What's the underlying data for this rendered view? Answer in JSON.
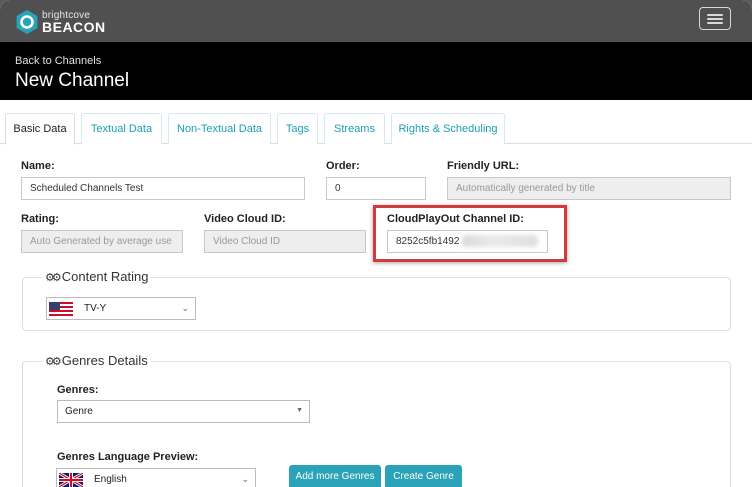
{
  "brand": {
    "small": "brightcove",
    "big": "BEACON",
    "color": "#2aa3b9"
  },
  "header": {
    "back_link": "Back to Channels",
    "title": "New Channel"
  },
  "tabs": [
    {
      "label": "Basic Data",
      "active": true
    },
    {
      "label": "Textual Data",
      "active": false
    },
    {
      "label": "Non-Textual Data",
      "active": false
    },
    {
      "label": "Tags",
      "active": false
    },
    {
      "label": "Streams",
      "active": false
    },
    {
      "label": "Rights & Scheduling",
      "active": false
    }
  ],
  "form": {
    "name": {
      "label": "Name:",
      "value": "Scheduled Channels Test"
    },
    "order": {
      "label": "Order:",
      "value": "0"
    },
    "friendly_url": {
      "label": "Friendly URL:",
      "placeholder": "Automatically generated by title"
    },
    "rating": {
      "label": "Rating:",
      "placeholder": "Auto Generated by average use"
    },
    "video_cloud_id": {
      "label": "Video Cloud ID:",
      "placeholder": "Video Cloud ID"
    },
    "cloudplayout_id": {
      "label": "CloudPlayOut Channel ID:",
      "value": "8252c5fb1492"
    }
  },
  "content_rating": {
    "legend": "Content Rating",
    "selected": "TV-Y",
    "flag": "us-flag-icon"
  },
  "genres_details": {
    "legend": "Genres Details",
    "genres_label": "Genres:",
    "genres_selected": "Genre",
    "language_label": "Genres Language Preview:",
    "language_selected": "English",
    "language_flag": "uk-flag-icon",
    "add_more_button": "Add more Genres",
    "create_button": "Create Genre"
  }
}
